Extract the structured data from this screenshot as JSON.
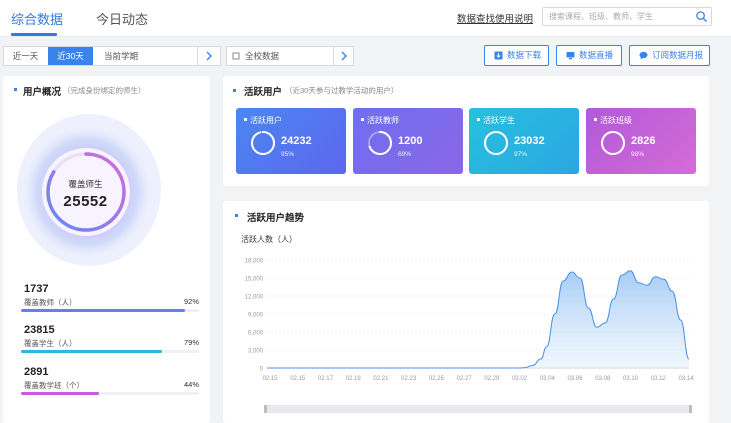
{
  "header": {
    "tabs": [
      {
        "label": "综合数据"
      },
      {
        "label": "今日动态"
      }
    ],
    "help_link": "数据查找使用说明",
    "search_placeholder": "搜索课程、班级、教师、学生"
  },
  "filters": {
    "period_options": [
      "近一天",
      "近30天",
      "当前学期"
    ],
    "active_period": "近30天",
    "school_scope": "全校数据"
  },
  "actions": {
    "download": "数据下载",
    "screen": "数据直播",
    "subscribe": "订阅数据月报"
  },
  "user_overview": {
    "title": "用户概况",
    "subtitle": "（完成身份绑定的师生）",
    "center_label": "覆盖师生",
    "center_value": "25552",
    "stats": [
      {
        "value": "1737",
        "label": "覆盖教师（人）",
        "percent": "92%",
        "fraction": 0.92,
        "color": "#6a7cf0"
      },
      {
        "value": "23815",
        "label": "覆盖学生（人）",
        "percent": "79%",
        "fraction": 0.79,
        "color": "#2bb8dc"
      },
      {
        "value": "2891",
        "label": "覆盖教学班（个）",
        "percent": "44%",
        "fraction": 0.44,
        "color": "#c25ed8"
      }
    ]
  },
  "active_users": {
    "title": "活跃用户",
    "subtitle": "（近30天参与过教学活动的用户）",
    "tiles": [
      {
        "name": "活跃用户",
        "value": "24232",
        "percent": "95%",
        "fraction": 0.95,
        "c1": "#4b87f1",
        "c2": "#5d66ee"
      },
      {
        "name": "活跃教师",
        "value": "1200",
        "percent": "69%",
        "fraction": 0.69,
        "c1": "#6d6ff0",
        "c2": "#8b67e8"
      },
      {
        "name": "活跃学生",
        "value": "23032",
        "percent": "97%",
        "fraction": 0.97,
        "c1": "#27c1dd",
        "c2": "#2ba6e3"
      },
      {
        "name": "活跃班级",
        "value": "2826",
        "percent": "98%",
        "fraction": 0.98,
        "c1": "#b05ad9",
        "c2": "#d66bd6"
      }
    ]
  },
  "trend": {
    "title": "活跃用户趋势",
    "ylabel": "活跃人数（人）"
  },
  "chart_data": {
    "type": "area",
    "ylabel": "活跃人数（人）",
    "ylim": [
      0,
      18000
    ],
    "yticks": [
      "0",
      "3,000",
      "6,000",
      "9,000",
      "12,000",
      "15,000",
      "18,000"
    ],
    "x_tick_labels": [
      "02.15",
      "02.15",
      "02.17",
      "02.19",
      "02.21",
      "02.23",
      "02.25",
      "02.27",
      "02.29",
      "03.02",
      "03.04",
      "03.06",
      "03.08",
      "03.10",
      "03.12",
      "03.14"
    ],
    "x": [
      0,
      0.5,
      1,
      1.5,
      2,
      2.5,
      3,
      3.5,
      4,
      4.5,
      5,
      5.5,
      6,
      6.5,
      7,
      7.5,
      8,
      8.5,
      9,
      9.2,
      9.5,
      9.8,
      10,
      10.3,
      10.6,
      10.9,
      11.2,
      11.5,
      11.8,
      12.1,
      12.4,
      12.7,
      13.0,
      13.3,
      13.6,
      13.9,
      14.2,
      14.5,
      14.8,
      15.1
    ],
    "values": [
      0,
      0,
      0,
      0,
      0,
      0,
      0,
      0,
      0,
      0,
      0,
      0,
      0,
      0,
      0,
      0,
      0,
      0,
      0,
      50,
      400,
      1500,
      3500,
      9000,
      14500,
      16000,
      15000,
      10000,
      6800,
      7500,
      11500,
      15500,
      16200,
      14200,
      13800,
      15200,
      14800,
      12800,
      8000,
      1500
    ],
    "grid": true
  }
}
